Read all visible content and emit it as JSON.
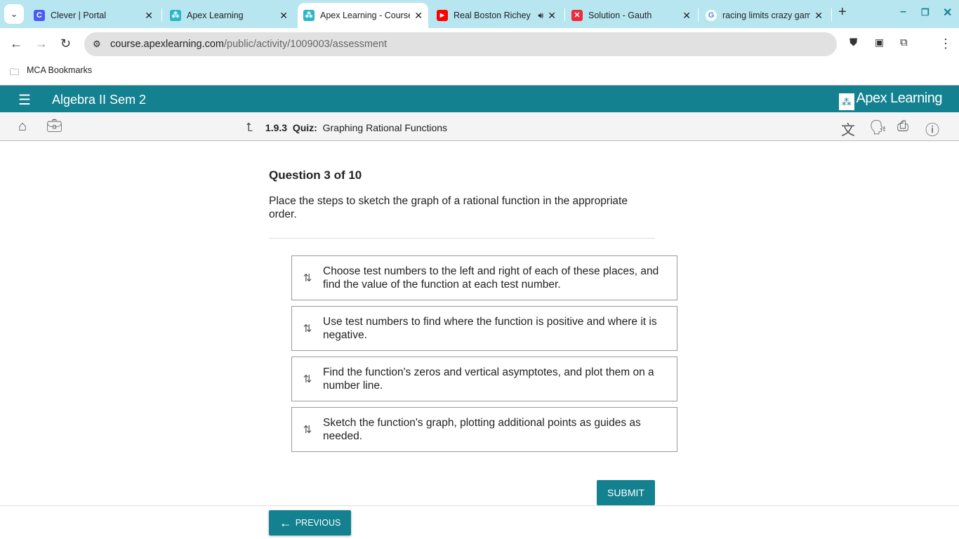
{
  "browser": {
    "tabs": [
      {
        "title": "Clever | Portal",
        "icon": "clever-icon",
        "color": "#4a5cf0",
        "glyph": "C"
      },
      {
        "title": "Apex Learning",
        "icon": "apex-icon",
        "color": "#2bb5c9",
        "glyph": "A"
      },
      {
        "title": "Apex Learning - Course",
        "icon": "apex-icon",
        "color": "#2bb5c9",
        "glyph": "A"
      },
      {
        "title": "Real Boston Richey",
        "icon": "youtube-icon",
        "color": "#f00",
        "glyph": "▶"
      },
      {
        "title": "Solution - Gauth",
        "icon": "gauth-icon",
        "color": "#f0283c",
        "glyph": "✕"
      },
      {
        "title": "racing limits crazy games",
        "icon": "google-icon",
        "color": "#fff",
        "glyph": "G"
      }
    ],
    "url_host": "course.apexlearning.com",
    "url_path": "/public/activity/1009003/assessment",
    "bookmark": "MCA Bookmarks"
  },
  "app": {
    "course": "Algebra II Sem 2",
    "logo": "Apex Learning",
    "crumb_num": "1.9.3",
    "crumb_type": "Quiz:",
    "crumb_title": "Graphing Rational Functions"
  },
  "question": {
    "number": "Question 3 of 10",
    "prompt": "Place the steps to sketch the graph of a rational function in the appropriate order.",
    "items": [
      "Choose test numbers to the left and right of each of these places, and find the value of the function at each test number.",
      "Use test numbers to find where the function is positive and where it is negative.",
      "Find the function's zeros and vertical asymptotes, and plot them on a number line.",
      "Sketch the function's graph, plotting additional points as guides as needed."
    ],
    "submit": "SUBMIT",
    "previous": "PREVIOUS"
  }
}
